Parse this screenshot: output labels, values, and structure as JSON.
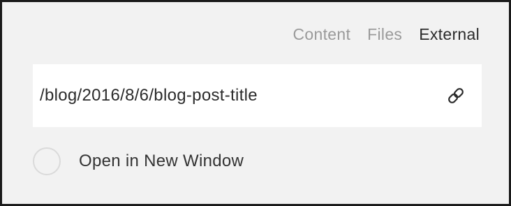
{
  "tabs": [
    {
      "label": "Content",
      "active": false
    },
    {
      "label": "Files",
      "active": false
    },
    {
      "label": "External",
      "active": true
    }
  ],
  "url_field": {
    "value": "/blog/2016/8/6/blog-post-title",
    "icon": "link-icon"
  },
  "open_in_new_window": {
    "label": "Open in New Window",
    "checked": false
  },
  "colors": {
    "panel_background": "#f2f2f2",
    "input_background": "#ffffff",
    "active_tab": "#2b2b2b",
    "inactive_tab": "#9a9a9a",
    "radio_border": "#dadada"
  }
}
